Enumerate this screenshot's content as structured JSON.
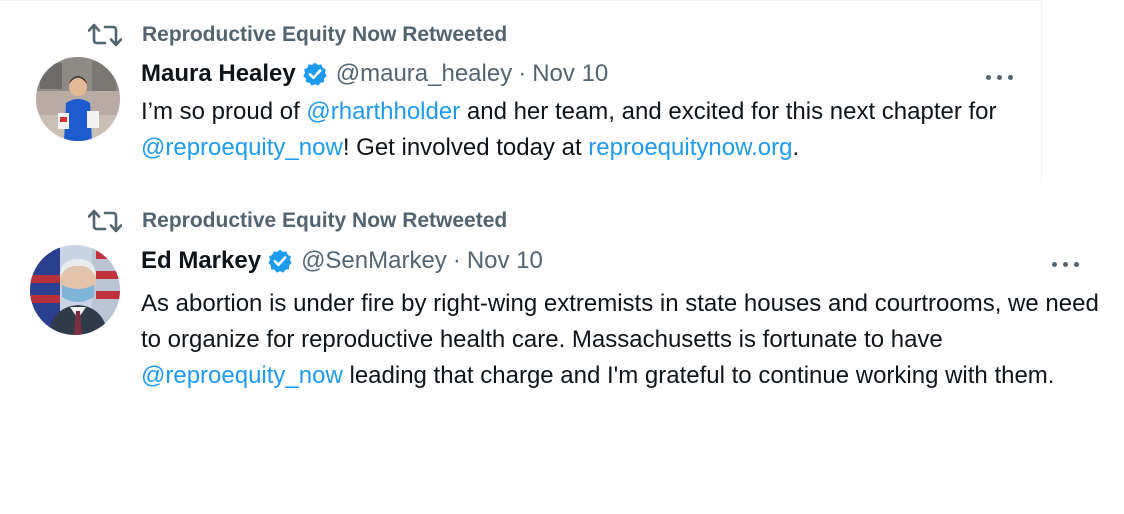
{
  "tweets": [
    {
      "retweeted_by": "Reproductive Equity Now Retweeted",
      "display_name": "Maura Healey",
      "handle": "@maura_healey",
      "separator": "·",
      "date": "Nov 10",
      "verified": true,
      "icons": {
        "retweet": "retweet-icon",
        "verified": "verified-badge-icon",
        "more": "more-options-icon"
      },
      "text": {
        "t1": "I’m so proud of ",
        "m1": "@rharthholder",
        "t2": " and her team, and excited for this next chapter for ",
        "m2": "@reproequity_now",
        "t3": "! Get involved today at ",
        "link": "reproequitynow.org",
        "t4": "."
      }
    },
    {
      "retweeted_by": "Reproductive Equity Now Retweeted",
      "display_name": "Ed Markey",
      "handle": "@SenMarkey",
      "separator": "·",
      "date": "Nov 10",
      "verified": true,
      "icons": {
        "retweet": "retweet-icon",
        "verified": "verified-badge-icon",
        "more": "more-options-icon"
      },
      "text": {
        "t1": "As abortion is under fire by right-wing extremists in state houses and courtrooms, we need to organize for reproductive health care. Massachusetts is fortunate to have ",
        "m1": "@reproequity_now",
        "t2": " leading that charge and I'm grateful to continue working with them."
      }
    }
  ],
  "colors": {
    "text": "#0f1419",
    "secondary": "#536471",
    "link": "#1d9bf0",
    "verified": "#1d9bf0"
  }
}
